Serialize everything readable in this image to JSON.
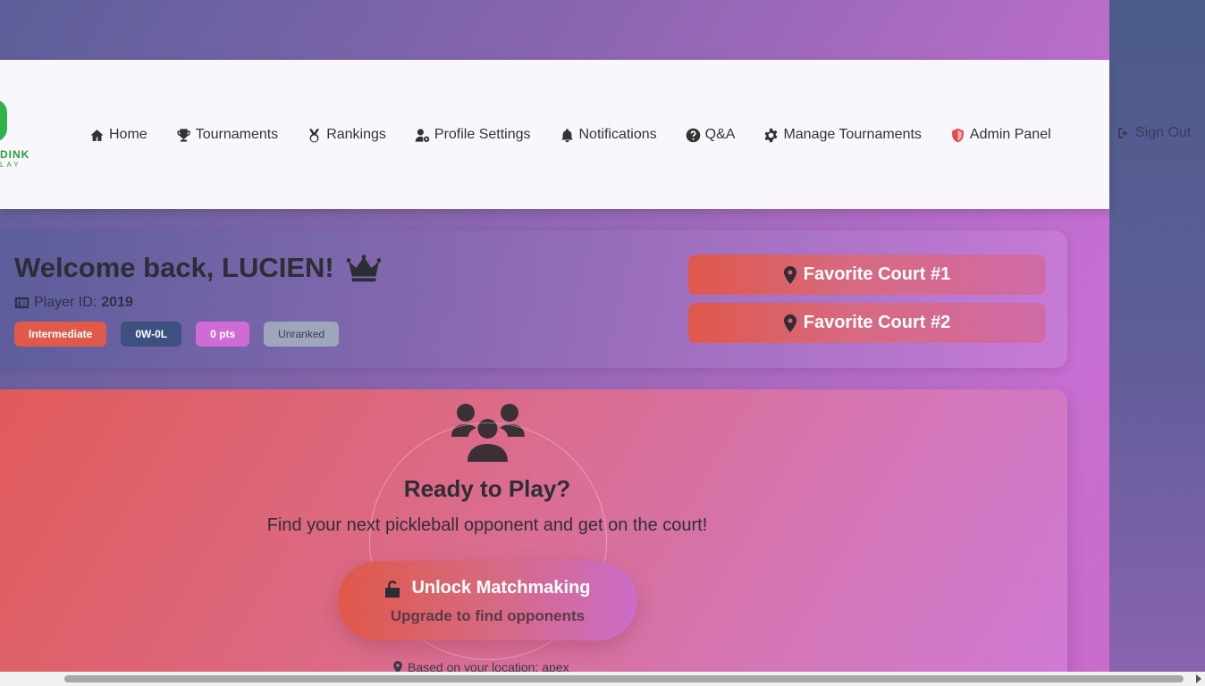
{
  "nav": {
    "logo_text": "DINK",
    "logo_sub": "LAY",
    "items": [
      {
        "label": "Home",
        "icon": "home-icon"
      },
      {
        "label": "Tournaments",
        "icon": "trophy-icon"
      },
      {
        "label": "Rankings",
        "icon": "medal-icon"
      },
      {
        "label": "Profile Settings",
        "icon": "user-gear-icon"
      },
      {
        "label": "Notifications",
        "icon": "bell-icon"
      },
      {
        "label": "Q&A",
        "icon": "question-circle-icon"
      },
      {
        "label": "Manage Tournaments",
        "icon": "gear-icon"
      },
      {
        "label": "Admin Panel",
        "icon": "shield-icon"
      }
    ],
    "signout": "Sign Out"
  },
  "welcome": {
    "title": "Welcome back, LUCIEN!",
    "player_id_label": "Player ID:",
    "player_id": "2019",
    "badges": {
      "level": "Intermediate",
      "record": "0W-0L",
      "points": "0 pts",
      "rank": "Unranked"
    },
    "favorites": [
      "Favorite Court #1",
      "Favorite Court #2"
    ]
  },
  "play": {
    "title": "Ready to Play?",
    "subtitle": "Find your next pickleball opponent and get on the court!",
    "button_main": "Unlock Matchmaking",
    "button_sub": "Upgrade to find opponents",
    "location": "Based on your location: apex"
  },
  "colors": {
    "accent_red": "#e0584a",
    "accent_pink": "#d06ad4",
    "navy": "#3d5080",
    "logo_green": "#2fb24a"
  }
}
